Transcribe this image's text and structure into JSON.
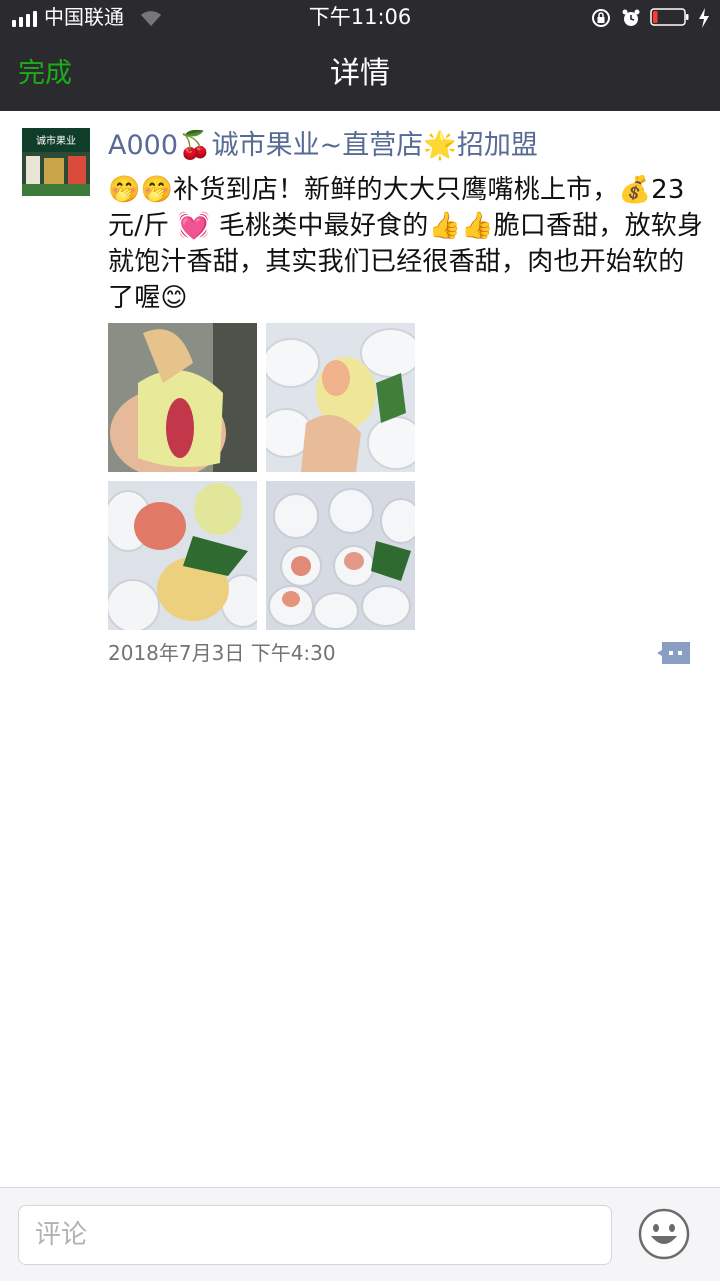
{
  "status_bar": {
    "carrier": "中国联通",
    "time": "下午11:06",
    "battery_level": 0.15,
    "signal_icon": "signal-bars-icon",
    "wifi_icon": "wifi-icon"
  },
  "nav": {
    "done_label": "完成",
    "title": "详情"
  },
  "post": {
    "avatar_sign_text": "诚市果业",
    "author": "A000🍒诚市果业~直营店🌟招加盟",
    "text": "🤭🤭补货到店！新鲜的大大只鹰嘴桃上市，💰23元/斤 💓 毛桃类中最好食的👍👍脆口香甜，放软身就饱汁香甜，其实我们已经很香甜，肉也开始软的了喔😊",
    "photo_count": 4,
    "time": "2018年7月3日 下午4:30"
  },
  "comment_bar": {
    "placeholder": "评论"
  },
  "colors": {
    "nav_bg": "#2b2b2f",
    "accent_green": "#1aad19",
    "author_blue": "#576b95",
    "timestamp_gray": "#737373"
  }
}
